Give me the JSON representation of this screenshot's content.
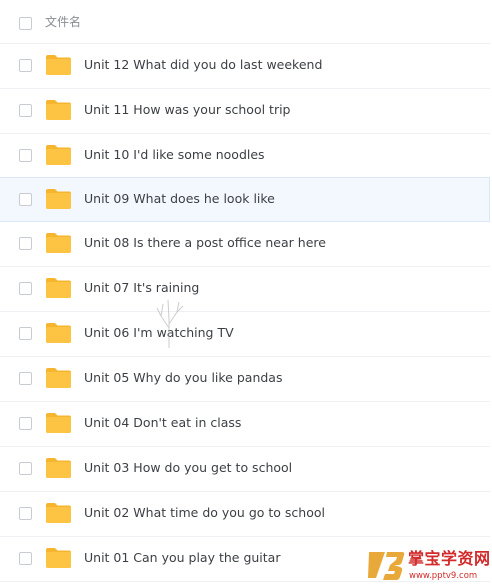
{
  "header": {
    "filename_label": "文件名"
  },
  "folders": [
    "Unit 12 What did you do last weekend",
    "Unit 11 How was your school trip",
    "Unit 10 I'd like some noodles",
    "Unit 09 What does he look like",
    "Unit 08 Is there a post office near here",
    "Unit 07 It's raining",
    "Unit 06 I'm watching TV",
    "Unit 05 Why do you like pandas",
    "Unit 04 Don't eat in class",
    "Unit 03 How do you get to school",
    "Unit 02 What time do you go to school",
    "Unit 01 Can you play the guitar"
  ],
  "watermark": {
    "title": "掌宝学资网",
    "url": "www.pptv9.com"
  },
  "colors": {
    "folder": "#fcc442",
    "folder_tab": "#f5b52e",
    "hover_row": "#f3f8fe",
    "watermark": "#d22a2a"
  }
}
